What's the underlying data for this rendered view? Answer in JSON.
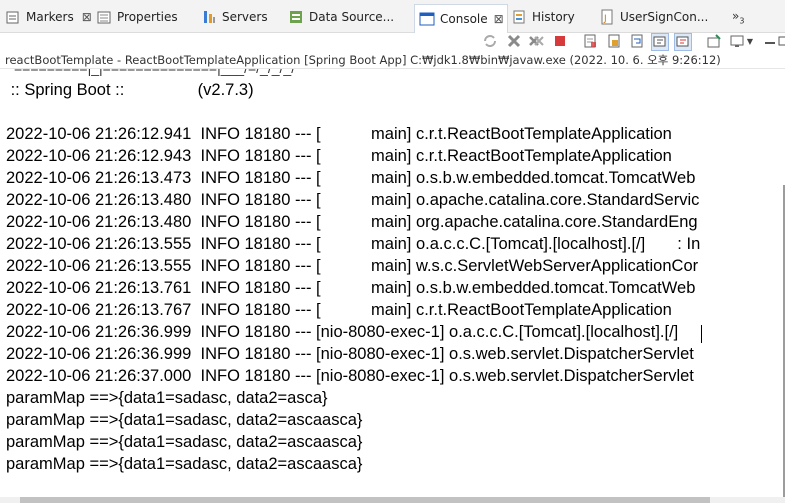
{
  "tabs": {
    "markers": "Markers",
    "markers_close": "⊠",
    "properties": "Properties",
    "servers": "Servers",
    "data_source": "Data Source...",
    "console": "Console",
    "console_close": "⊠",
    "history": "History",
    "usersign": "UserSignCon...",
    "overflow": "»",
    "overflow_count": "3"
  },
  "process_line": "reactBootTemplate - ReactBootTemplateApplication [Spring Boot App] C:₩jdk1.8₩bin₩javaw.exe  (2022. 10. 6. 오후 9:26:12)",
  "console": {
    "banner_cut": "=========|_|==============|___/=/_/_/_/",
    "spring_boot": " :: Spring Boot ::                (v2.7.3)",
    "log_lines": [
      "2022-10-06 21:26:12.941  INFO 18180 --- [           main] c.r.t.ReactBootTemplateApplication",
      "2022-10-06 21:26:12.943  INFO 18180 --- [           main] c.r.t.ReactBootTemplateApplication",
      "2022-10-06 21:26:13.473  INFO 18180 --- [           main] o.s.b.w.embedded.tomcat.TomcatWeb",
      "2022-10-06 21:26:13.480  INFO 18180 --- [           main] o.apache.catalina.core.StandardServic",
      "2022-10-06 21:26:13.480  INFO 18180 --- [           main] org.apache.catalina.core.StandardEng",
      "2022-10-06 21:26:13.555  INFO 18180 --- [           main] o.a.c.c.C.[Tomcat].[localhost].[/]       : In",
      "2022-10-06 21:26:13.555  INFO 18180 --- [           main] w.s.c.ServletWebServerApplicationCor",
      "2022-10-06 21:26:13.761  INFO 18180 --- [           main] o.s.b.w.embedded.tomcat.TomcatWeb",
      "2022-10-06 21:26:13.767  INFO 18180 --- [           main] c.r.t.ReactBootTemplateApplication",
      "2022-10-06 21:26:36.999  INFO 18180 --- [nio-8080-exec-1] o.a.c.c.C.[Tomcat].[localhost].[/]",
      "2022-10-06 21:26:36.999  INFO 18180 --- [nio-8080-exec-1] o.s.web.servlet.DispatcherServlet",
      "2022-10-06 21:26:37.000  INFO 18180 --- [nio-8080-exec-1] o.s.web.servlet.DispatcherServlet"
    ],
    "param_lines": [
      "paramMap ==>{data1=sadasc, data2=asca}",
      "paramMap ==>{data1=sadasc, data2=ascaasca}",
      "paramMap ==>{data1=sadasc, data2=ascaasca}",
      "paramMap ==>{data1=sadasc, data2=ascaasca}"
    ]
  },
  "colors": {
    "accent_blue": "#1f5fbf",
    "toolbar_red": "#d63a3a",
    "toolbar_green": "#2e8b57"
  },
  "icons": {
    "markers": "markers-icon",
    "properties": "properties-icon",
    "servers": "servers-icon",
    "data_source": "data-source-icon",
    "console": "console-icon",
    "history": "history-icon",
    "usersign": "java-file-icon"
  }
}
